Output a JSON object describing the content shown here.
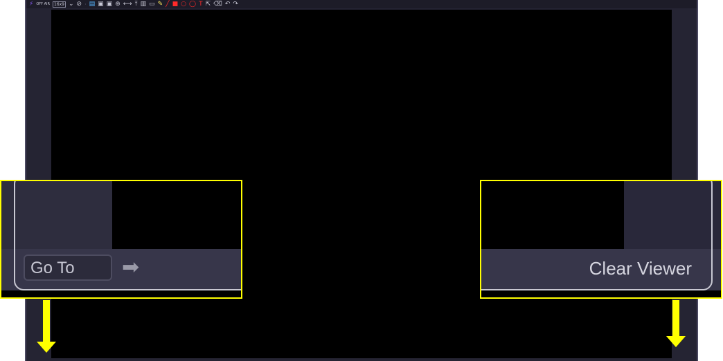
{
  "toolbar": {
    "off_air_label": "OFF AIR",
    "aspect_label": "16x9",
    "items": [
      "⚡",
      "16x9",
      "⌄",
      "⊘",
      "▤",
      "▣",
      "▣",
      "⊕",
      "⟷",
      "⤒",
      "▥",
      "▭",
      "✎",
      "╱",
      "■",
      "○",
      "◯",
      "T",
      "⇱",
      "⌫",
      "↶",
      "↷"
    ]
  },
  "left_callout": {
    "goto_label": "Go To",
    "goto_arrow": "➡"
  },
  "right_callout": {
    "clear_viewer_label": "Clear Viewer"
  },
  "colors": {
    "highlight": "#ffff00",
    "viewer_bg": "#000000",
    "panel_bg": "#252433"
  }
}
